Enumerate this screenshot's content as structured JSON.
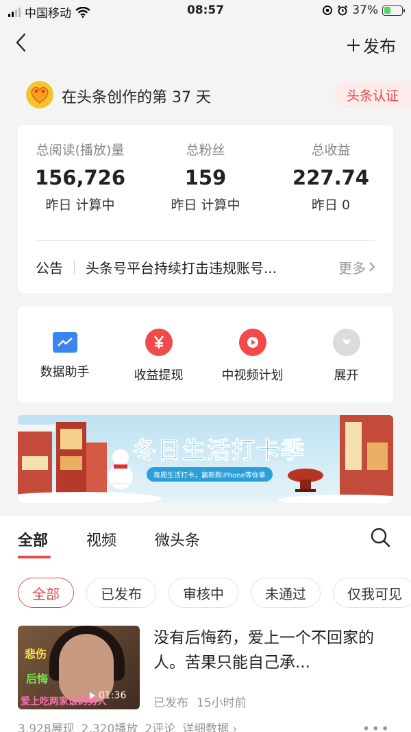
{
  "status_bar": {
    "carrier": "中国移动",
    "time": "08:57",
    "battery_percent": "37%",
    "battery_level": 0.37
  },
  "nav": {
    "publish_label": "发布"
  },
  "creator": {
    "days_text": "在头条创作的第 37 天",
    "cert_label": "头条认证"
  },
  "stats": [
    {
      "label": "总阅读(播放)量",
      "value": "156,726",
      "sub": "昨日 计算中"
    },
    {
      "label": "总粉丝",
      "value": "159",
      "sub": "昨日 计算中"
    },
    {
      "label": "总收益",
      "value": "227.74",
      "sub": "昨日 0"
    }
  ],
  "notice": {
    "tag": "公告",
    "text": "头条号平台持续打击违规账号...",
    "more": "更多"
  },
  "tools": [
    {
      "label": "数据助手",
      "icon": "chart-icon",
      "color": "#3a86f0"
    },
    {
      "label": "收益提现",
      "icon": "yen-icon",
      "color": "#f04a4a"
    },
    {
      "label": "中视频计划",
      "icon": "play-icon",
      "color": "#f04a4a"
    },
    {
      "label": "展开",
      "icon": "chevron-down-icon",
      "color": "#dcdcdc"
    }
  ],
  "banner": {
    "title": "冬日生活打卡季",
    "subtitle": "每周生活打卡，赢新款iPhone等你拿"
  },
  "tabs": [
    "全部",
    "视频",
    "微头条"
  ],
  "filters": [
    "全部",
    "已发布",
    "审核中",
    "未通过",
    "仅我可见"
  ],
  "article": {
    "title": "没有后悔药，爱上一个不回家的人。苦果只能自己承...",
    "status": "已发布",
    "time": "15小时前",
    "thumb_text1": "悲伤",
    "thumb_text2": "后悔",
    "thumb_caption": "爱上吃两家饭的男人",
    "duration": "01:36",
    "impressions": "3,928展现",
    "plays": "2,320播放",
    "comments": "2评论",
    "details": "详细数据"
  },
  "colors": {
    "accent": "#e54848",
    "text": "#222222",
    "muted": "#999999"
  }
}
